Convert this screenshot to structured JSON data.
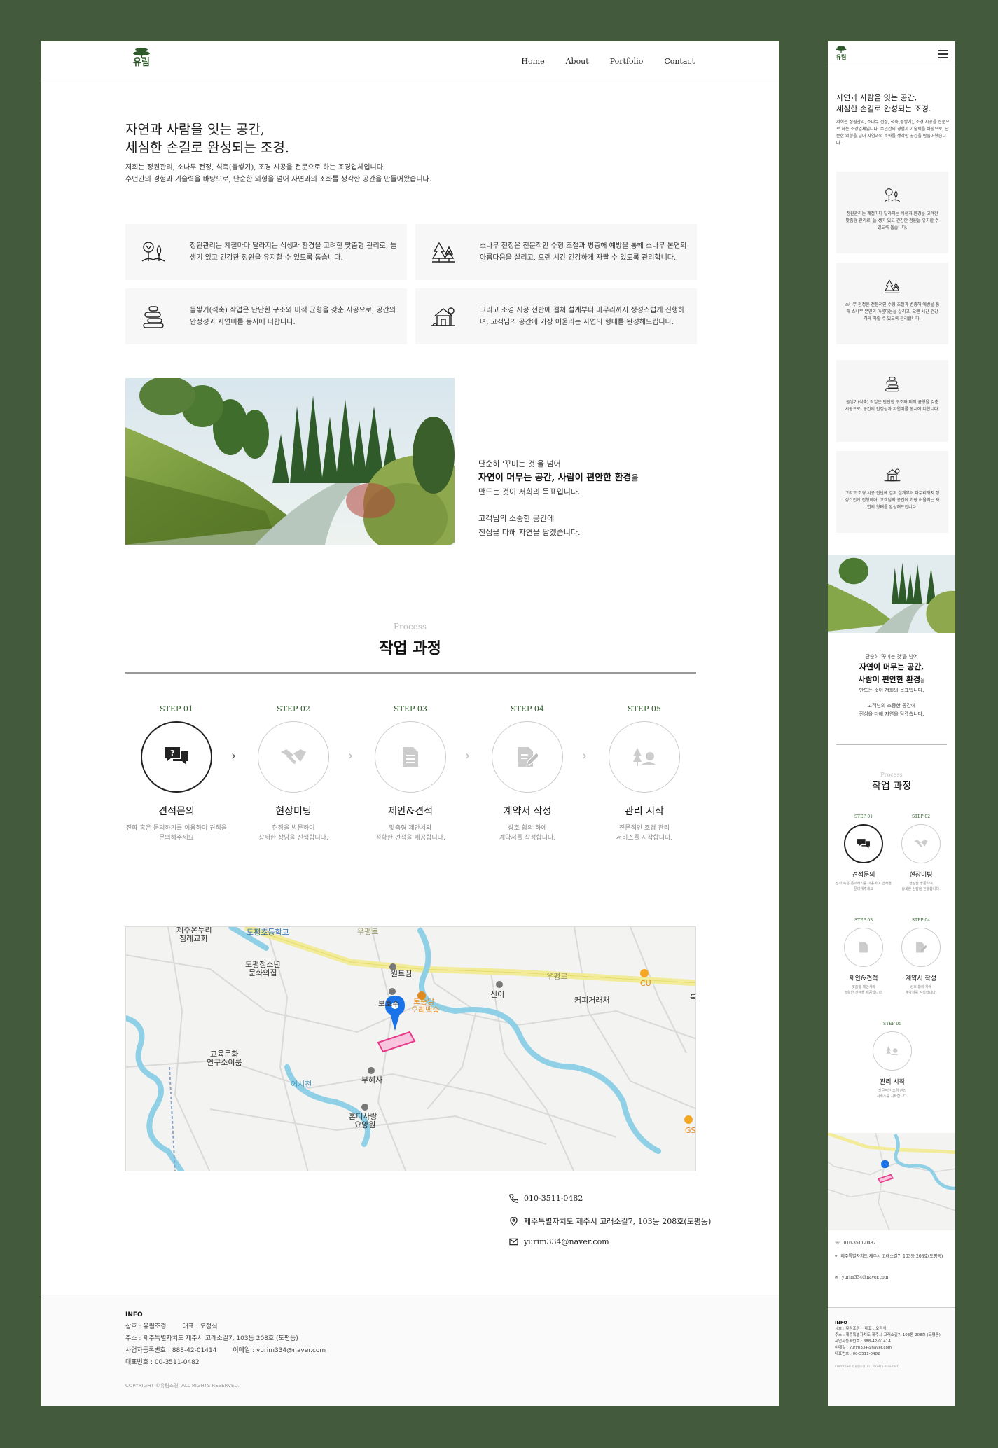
{
  "brand": {
    "name": "유림",
    "color": "#2e5a2a"
  },
  "nav": {
    "items": [
      "Home",
      "About",
      "Portfolio",
      "Contact"
    ]
  },
  "hero": {
    "title_line1": "자연과 사람을 잇는 공간,",
    "title_line2": "세심한 손길로 완성되는 조경.",
    "intro_line1": "저희는 정원관리, 소나무 전정, 석축(돌쌓기), 조경 시공을 전문으로 하는 조경업체입니다.",
    "intro_line2": "수년간의 경험과 기술력을 바탕으로, 단순한 외형을 넘어 자연과의 조화를 생각한 공간을 만들어왔습니다.",
    "mobile_intro": "저희는 정원관리, 소나무 전정, 석축(돌쌓기), 조경 시공을 전문으로 하는 조경업체입니다. 수년간의 경험과 기술력을 바탕으로, 단순한 외형을 넘어 자연과의 조화를 생각한 공간을 만들어왔습니다."
  },
  "services": [
    {
      "icon": "garden-tree-icon",
      "text": "정원관리는 계절마다 달라지는 식생과 환경을 고려한 맞춤형 관리로, 늘 생기 있고 건강한 정원을 유지할 수 있도록 돕습니다."
    },
    {
      "icon": "pine-tree-icon",
      "text": "소나무 전정은 전문적인 수형 조절과 병충해 예방을 통해 소나무 본연의 아름다움을 살리고, 오랜 시간 건강하게 자랄 수 있도록 관리합니다."
    },
    {
      "icon": "stone-stack-icon",
      "text": "돌쌓기(석축) 작업은 단단한 구조와 미적 균형을 갖춘 시공으로, 공간의 안정성과 자연미를 동시에 더합니다."
    },
    {
      "icon": "house-icon",
      "text": "그리고 조경 시공 전반에 걸쳐 설계부터 마무리까지 정성스럽게 진행하며, 고객님의 공간에 가장 어울리는 자연의 형태를 완성해드립니다."
    }
  ],
  "quote": {
    "line1": "단순히 '꾸미는 것'을 넘어",
    "line2_bold": "자연이 머무는 공간, 사람이 편안한 환경",
    "line2_tail": "을",
    "mobile_bold1": "자연이 머무는 공간,",
    "mobile_bold2": "사람이 편안한 환경",
    "line3": "만드는 것이 저희의 목표입니다.",
    "line4": "고객님의 소중한 공간에",
    "line5": "진심을 다해 자연을 담겠습니다."
  },
  "process": {
    "label": "Process",
    "title": "작업 과정",
    "steps": [
      {
        "step": "STEP 01",
        "name": "견적문의",
        "desc1": "전화 혹은 문의하기를 이용하여 견적을",
        "desc2": "문의해주세요",
        "icon": "chat-question-icon"
      },
      {
        "step": "STEP 02",
        "name": "현장미팅",
        "desc1": "현장을 방문하여",
        "desc2": "상세한 상담을 진행합니다.",
        "icon": "handshake-icon"
      },
      {
        "step": "STEP 03",
        "name": "제안&견적",
        "desc1": "맞춤형 제안서와",
        "desc2": "정확한 견적을 제공합니다.",
        "icon": "document-icon"
      },
      {
        "step": "STEP 04",
        "name": "계약서 작성",
        "desc1": "상호 합의 하에",
        "desc2": "계약서를 작성합니다.",
        "icon": "contract-icon"
      },
      {
        "step": "STEP 05",
        "name": "관리 시작",
        "desc1": "전문적인 조경 관리",
        "desc2": "서비스를 시작합니다.",
        "icon": "tree-care-icon"
      }
    ]
  },
  "map": {
    "labels": [
      "제주온누리",
      "침례교회",
      "도평초등학교",
      "도평청소년",
      "문화의집",
      "원트짐",
      "보호수",
      "토종닭",
      "오리백숙",
      "신이",
      "커피거래처",
      "CU",
      "교육문화",
      "연구소이룸",
      "부혜사",
      "혼디사랑",
      "요양원",
      "우평로",
      "어시천",
      "GS",
      "북"
    ],
    "road_color": "#f2ec9a",
    "river_color": "#8fd0e6",
    "marker_color": "#1a73e8",
    "plot_color": "#e8388a"
  },
  "contact": {
    "phone": "010-3511-0482",
    "address": "제주특별자치도 제주시 고래소길7, 103동 208호(도평동)",
    "email": "yurim334@naver.com"
  },
  "footer": {
    "title": "INFO",
    "company": "상호 : 유림조경",
    "ceo": "대표 : 오정식",
    "address": "주소 : 제주특별자치도 제주시 고래소길7, 103동 208호 (도평동)",
    "biz_no": "사업자등록번호 : 888-42-01414",
    "email": "이메일 : yurim334@naver.com",
    "tel": "대표번호 : 00-3511-0482",
    "copyright": "COPYRIGHT ©유림조경. ALL RIGHTS RESERVED."
  }
}
